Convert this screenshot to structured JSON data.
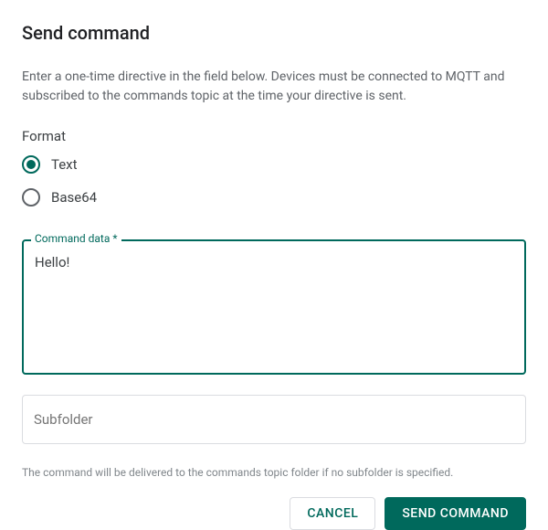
{
  "dialog": {
    "title": "Send command",
    "description": "Enter a one-time directive in the field below. Devices must be connected to MQTT and subscribed to the commands topic at the time your directive is sent."
  },
  "format": {
    "label": "Format",
    "options": [
      {
        "label": "Text",
        "checked": true
      },
      {
        "label": "Base64",
        "checked": false
      }
    ]
  },
  "command": {
    "label": "Command data *",
    "value": "Hello!"
  },
  "subfolder": {
    "placeholder": "Subfolder",
    "value": "",
    "helper": "The command will be delivered to the commands topic folder if no subfolder is specified."
  },
  "actions": {
    "cancel": "Cancel",
    "send": "Send Command"
  }
}
